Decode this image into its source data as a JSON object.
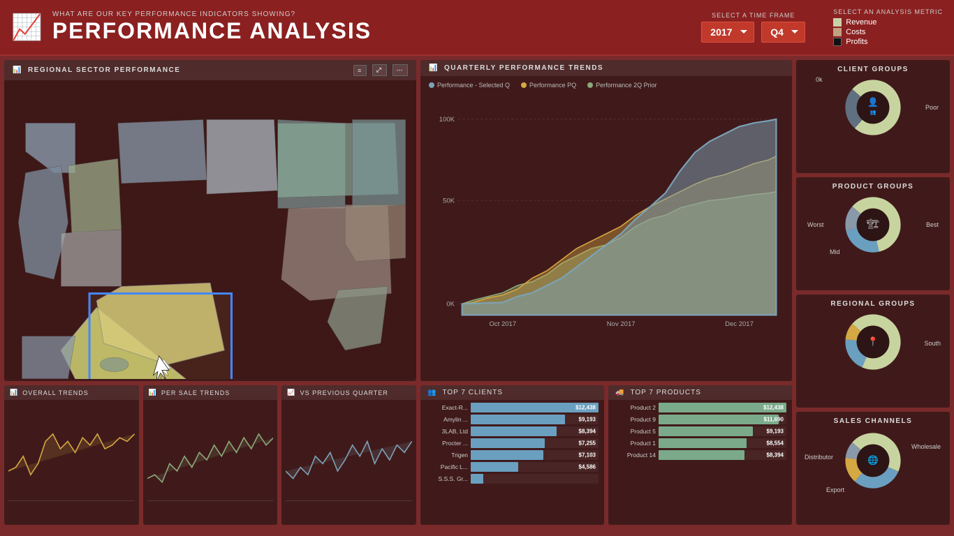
{
  "header": {
    "icon": "📈",
    "subtitle": "WHAT ARE OUR KEY PERFORMANCE INDICATORS SHOWING?",
    "title": "PERFORMANCE ANALYSIS",
    "timeframe_label": "SELECT A TIME FRAME",
    "year_value": "2017",
    "quarter_value": "Q4",
    "metric_label": "SELECT AN ANALYSIS METRIC",
    "metrics": [
      {
        "label": "Revenue",
        "color": "#c8d0a8",
        "checked": true
      },
      {
        "label": "Costs",
        "color": "#c0a080",
        "checked": true
      },
      {
        "label": "Profits",
        "color": "#1a1a1a",
        "checked": true
      }
    ]
  },
  "map_panel": {
    "title": "REGIONAL SECTOR PERFORMANCE"
  },
  "trends_panel": {
    "title": "QUARTERLY PERFORMANCE TRENDS",
    "legend": [
      {
        "label": "Performance - Selected Q",
        "color": "#7ba3b8"
      },
      {
        "label": "Performance PQ",
        "color": "#d4a843"
      },
      {
        "label": "Performance 2Q Prior",
        "color": "#8aaa7a"
      }
    ],
    "y_labels": [
      "100K",
      "50K",
      "0K"
    ],
    "x_labels": [
      "Oct 2017",
      "Nov 2017",
      "Dec 2017"
    ]
  },
  "bottom_charts": [
    {
      "title": "OVERALL TRENDS",
      "icon": "📊"
    },
    {
      "title": "PER SALE TRENDS",
      "icon": "📊"
    },
    {
      "title": "VS PREVIOUS QUARTER",
      "icon": "📈"
    }
  ],
  "top_clients": {
    "title": "TOP 7 CLIENTS",
    "items": [
      {
        "label": "Exact-R...",
        "value": "$12,438",
        "pct": 100
      },
      {
        "label": "Amylin ...",
        "value": "$9,193",
        "pct": 74
      },
      {
        "label": "3LAB, Ltd",
        "value": "$8,394",
        "pct": 67
      },
      {
        "label": "Procter ...",
        "value": "$7,255",
        "pct": 58
      },
      {
        "label": "Trigen",
        "value": "$7,103",
        "pct": 57
      },
      {
        "label": "Pacific L...",
        "value": "$4,586",
        "pct": 37
      },
      {
        "label": "S.S.S. Gr...",
        "value": "",
        "pct": 10
      }
    ],
    "bar_color": "#6a9fc0"
  },
  "top_products": {
    "title": "TOP 7 PRODUCTS",
    "items": [
      {
        "label": "Product 2",
        "value": "$12,438",
        "pct": 100
      },
      {
        "label": "Product 9",
        "value": "$11,690",
        "pct": 94
      },
      {
        "label": "Product 5",
        "value": "$9,193",
        "pct": 74
      },
      {
        "label": "Product 1",
        "value": "$8,554",
        "pct": 69
      },
      {
        "label": "Product 14",
        "value": "$8,394",
        "pct": 67
      }
    ],
    "bar_color": "#7aaa8a"
  },
  "client_groups": {
    "title": "CLIENT GROUPS",
    "label_top": "0k",
    "label_right": "Poor",
    "segments": [
      {
        "color": "#c8d4a0",
        "value": 75
      },
      {
        "color": "#8899aa",
        "value": 25
      }
    ]
  },
  "product_groups": {
    "title": "PRODUCT GROUPS",
    "label_left": "Worst",
    "label_right": "Best",
    "label_bottom": "Mid",
    "segments": [
      {
        "color": "#c8d4a0",
        "value": 60
      },
      {
        "color": "#6a9fc0",
        "value": 25
      },
      {
        "color": "#8899aa",
        "value": 15
      }
    ]
  },
  "regional_groups": {
    "title": "REGIONAL GROUPS",
    "label_right": "South",
    "segments": [
      {
        "color": "#c8d4a0",
        "value": 70
      },
      {
        "color": "#6a9fc0",
        "value": 20
      },
      {
        "color": "#d4a843",
        "value": 10
      }
    ]
  },
  "sales_channels": {
    "title": "SALES CHANNELS",
    "label_left": "Distributor",
    "label_right": "Wholesale",
    "label_bottom": "Export",
    "segments": [
      {
        "color": "#c8d4a0",
        "value": 45
      },
      {
        "color": "#6a9fc0",
        "value": 30
      },
      {
        "color": "#d4a843",
        "value": 15
      },
      {
        "color": "#8899aa",
        "value": 10
      }
    ]
  }
}
